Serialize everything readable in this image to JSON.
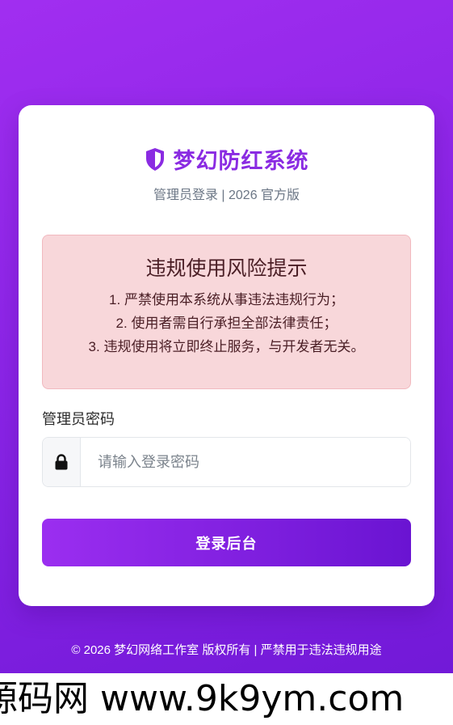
{
  "brand": {
    "title": "梦幻防红系统",
    "icon": "shield-icon",
    "color": "#8a2be2"
  },
  "subtitle": "管理员登录 | 2026 官方版",
  "warning": {
    "title": "违规使用风险提示",
    "lines": [
      "1. 严禁使用本系统从事违法违规行为；",
      "2. 使用者需自行承担全部法律责任；",
      "3. 违规使用将立即终止服务，与开发者无关。"
    ]
  },
  "form": {
    "password_label": "管理员密码",
    "password_placeholder": "请输入登录密码",
    "lock_icon": "lock-icon",
    "submit_label": "登录后台"
  },
  "footer": "© 2026 梦幻网络工作室 版权所有 | 严禁用于违法违规用途",
  "watermark": "源码网 www.9k9ym.com",
  "colors": {
    "accent": "#8a2be2",
    "background_start": "#a12ef0",
    "background_end": "#6f18d6",
    "warning_bg": "#f8d7da"
  }
}
